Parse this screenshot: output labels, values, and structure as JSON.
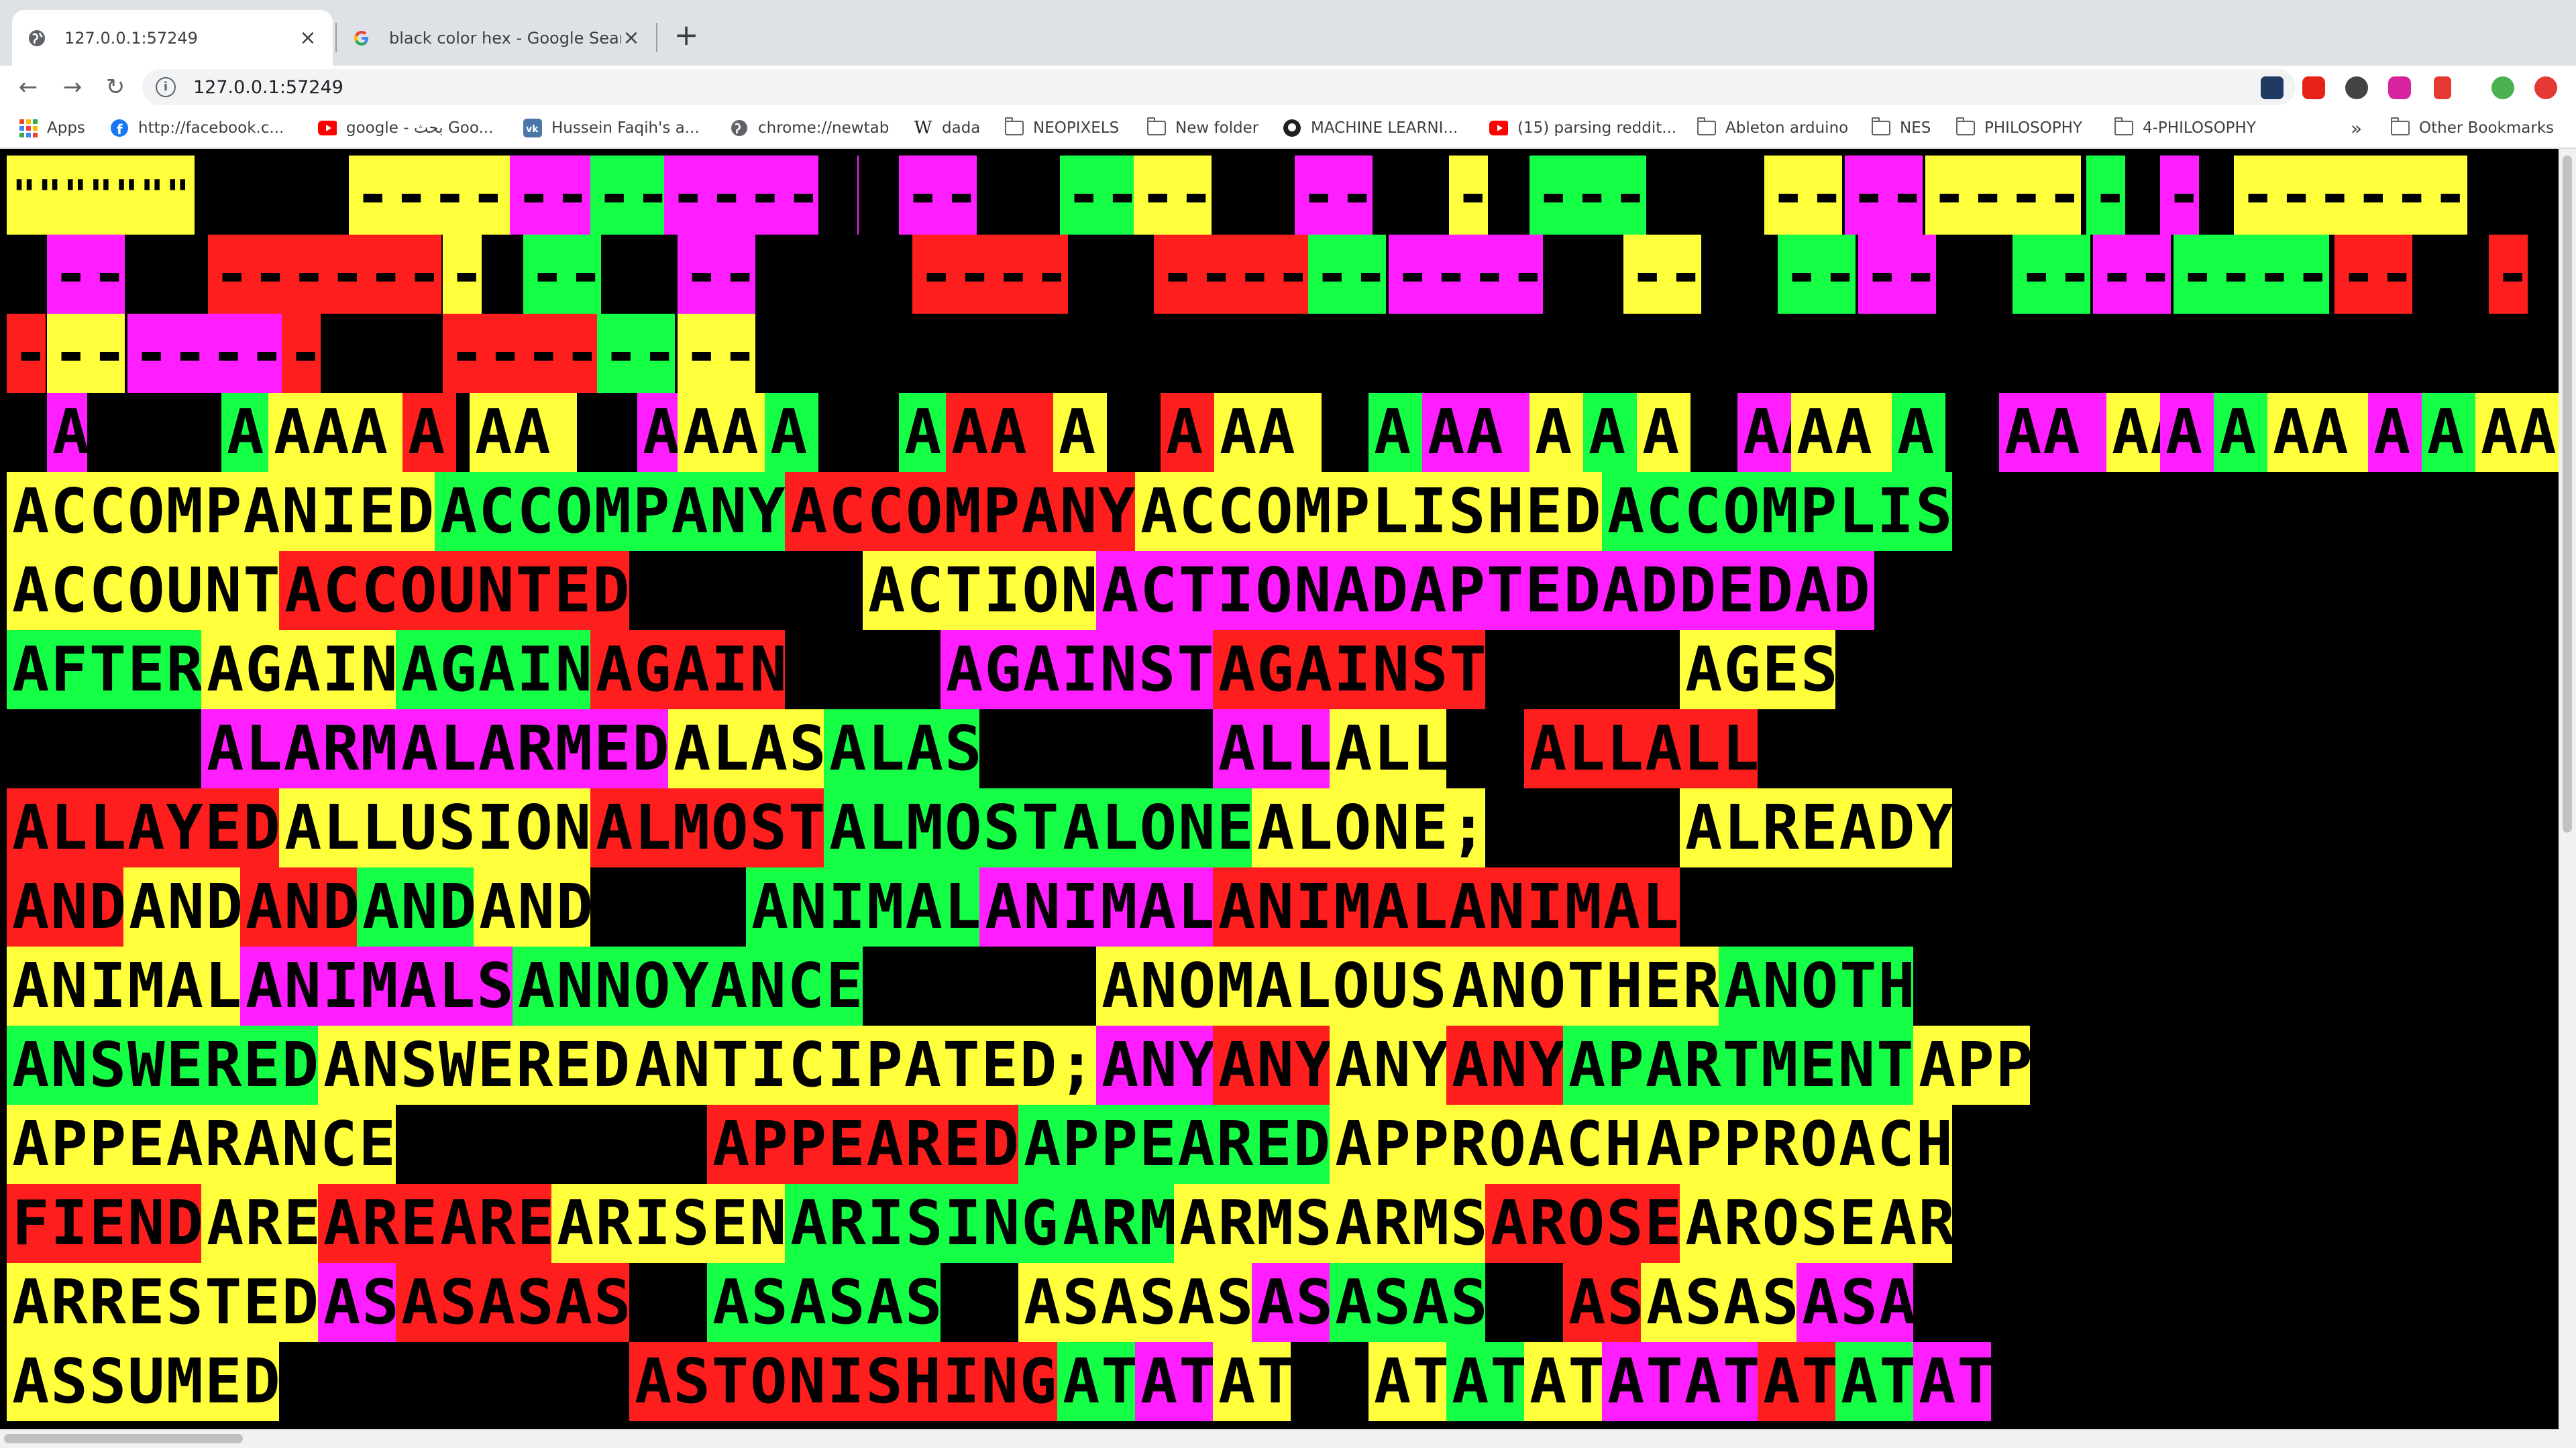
{
  "colors": {
    "yellow": "#ffff3c",
    "magenta": "#ff1eff",
    "green": "#14ff46",
    "red": "#ff1e1e",
    "black": "#000000"
  },
  "tabs": [
    {
      "title": "127.0.0.1:57249",
      "icon": "globe-icon"
    },
    {
      "title": "black color hex - Google Search",
      "icon": "google-icon"
    }
  ],
  "address_bar": {
    "url": "127.0.0.1:57249"
  },
  "bookmarks": [
    {
      "label": "Apps",
      "icon": "apps-grid-icon"
    },
    {
      "label": "http://facebook.c...",
      "icon": "facebook-icon"
    },
    {
      "label": "google - بحث Goo...",
      "icon": "youtube-icon"
    },
    {
      "label": "Hussein Faqih's a...",
      "icon": "vk-icon"
    },
    {
      "label": "chrome://newtab",
      "icon": "globe-icon"
    },
    {
      "label": "dada",
      "icon": "wikipedia-icon"
    },
    {
      "label": "NEOPIXELS",
      "icon": "folder-icon"
    },
    {
      "label": "New folder",
      "icon": "folder-icon"
    },
    {
      "label": "MACHINE LEARNI...",
      "icon": "github-icon"
    },
    {
      "label": "(15) parsing reddit...",
      "icon": "youtube-icon"
    },
    {
      "label": "Ableton arduino",
      "icon": "folder-icon"
    },
    {
      "label": "NES",
      "icon": "folder-icon"
    },
    {
      "label": "PHILOSOPHY",
      "icon": "folder-icon"
    },
    {
      "label": "4-PHILOSOPHY",
      "icon": "folder-icon"
    }
  ],
  "bookmarks_overflow": "»",
  "other_bookmarks": "Other Bookmarks",
  "rows": [
    [
      [
        "y",
        "\"\"\"\"\"\"\" \""
      ]
    ],
    [],
    [],
    [],
    [
      [
        "y",
        "ACCOMPANIED"
      ],
      [
        "g",
        "ACCOMPANY"
      ],
      [
        "r",
        "ACCOMPANY"
      ],
      [
        "y",
        "ACCOMPLISHED"
      ],
      [
        "g",
        "ACCOMPLIS"
      ]
    ],
    [
      [
        "y",
        "ACCOUNT"
      ],
      [
        "r",
        "ACCOUNTED"
      ],
      [
        "k",
        "      "
      ],
      [
        "y",
        "ACTION"
      ],
      [
        "m",
        "ACTIONADAPTEDADDEDAD"
      ]
    ],
    [
      [
        "g",
        "AFTER"
      ],
      [
        "y",
        "AGAIN"
      ],
      [
        "g",
        "AGAIN"
      ],
      [
        "r",
        "AGAIN"
      ],
      [
        "k",
        "    "
      ],
      [
        "m",
        "AGAINST"
      ],
      [
        "r",
        "AGAINST"
      ],
      [
        "k",
        "     "
      ],
      [
        "y",
        "AGES"
      ]
    ],
    [
      [
        "k",
        "     "
      ],
      [
        "m",
        "ALARM"
      ],
      [
        "m",
        "ALARMED"
      ],
      [
        "y",
        "ALAS"
      ],
      [
        "g",
        "ALAS"
      ],
      [
        "k",
        "      "
      ],
      [
        "m",
        "ALL"
      ],
      [
        "y",
        "ALL"
      ],
      [
        "k",
        "  "
      ],
      [
        "r",
        "ALLALL"
      ]
    ],
    [
      [
        "r",
        "ALLAYED"
      ],
      [
        "y",
        "ALLUSION"
      ],
      [
        "r",
        "ALMOST"
      ],
      [
        "g",
        "ALMOST"
      ],
      [
        "g",
        "ALONE"
      ],
      [
        "y",
        "ALONE;"
      ],
      [
        "k",
        "     "
      ],
      [
        "y",
        "ALREADY"
      ]
    ],
    [
      [
        "r",
        "AND"
      ],
      [
        "y",
        "AND"
      ],
      [
        "r",
        "AND"
      ],
      [
        "g",
        "AND"
      ],
      [
        "y",
        "AND"
      ],
      [
        "k",
        "    "
      ],
      [
        "g",
        "ANIMAL"
      ],
      [
        "m",
        "ANIMAL"
      ],
      [
        "r",
        "ANIMALANIMAL"
      ]
    ],
    [
      [
        "y",
        "ANIMAL"
      ],
      [
        "m",
        "ANIMALS"
      ],
      [
        "g",
        "ANNOYANCE"
      ],
      [
        "k",
        "      "
      ],
      [
        "y",
        "ANOMALOUS"
      ],
      [
        "y",
        "ANOTHER"
      ],
      [
        "g",
        "ANOTH"
      ]
    ],
    [
      [
        "g",
        "ANSWERED"
      ],
      [
        "y",
        "ANSWERED"
      ],
      [
        "y",
        "ANTICIPATED;"
      ],
      [
        "m",
        "ANY"
      ],
      [
        "r",
        "ANY"
      ],
      [
        "y",
        "ANY"
      ],
      [
        "r",
        "ANY"
      ],
      [
        "g",
        "APARTMENT"
      ],
      [
        "y",
        "APP"
      ]
    ],
    [
      [
        "y",
        "APPEARANCE"
      ],
      [
        "k",
        "        "
      ],
      [
        "r",
        "APPEARED"
      ],
      [
        "g",
        "APPEARED"
      ],
      [
        "y",
        "APPROACH"
      ],
      [
        "y",
        "APPROACH"
      ]
    ],
    [
      [
        "r",
        "FIEND"
      ],
      [
        "y",
        "ARE"
      ],
      [
        "r",
        "ARE"
      ],
      [
        "r",
        "ARE"
      ],
      [
        "y",
        "ARISEN"
      ],
      [
        "g",
        "ARISING"
      ],
      [
        "g",
        "ARM"
      ],
      [
        "y",
        "ARMS"
      ],
      [
        "y",
        "ARMS"
      ],
      [
        "r",
        "AROSE"
      ],
      [
        "y",
        "AROSE"
      ],
      [
        "y",
        "AR"
      ]
    ],
    [
      [
        "y",
        "ARRESTED"
      ],
      [
        "m",
        "AS"
      ],
      [
        "r",
        "ASASAS"
      ],
      [
        "k",
        "  "
      ],
      [
        "g",
        "ASASAS"
      ],
      [
        "k",
        "  "
      ],
      [
        "y",
        "ASASAS"
      ],
      [
        "m",
        "AS"
      ],
      [
        "g",
        "ASAS"
      ],
      [
        "k",
        "  "
      ],
      [
        "r",
        "AS"
      ],
      [
        "y",
        "ASAS"
      ],
      [
        "m",
        "ASA"
      ]
    ],
    [
      [
        "y",
        "ASSUMED"
      ],
      [
        "k",
        "         "
      ],
      [
        "r",
        "ASTONISHING"
      ],
      [
        "g",
        "AT"
      ],
      [
        "m",
        "AT"
      ],
      [
        "y",
        "AT"
      ],
      [
        "k",
        "  "
      ],
      [
        "y",
        "AT"
      ],
      [
        "g",
        "AT"
      ],
      [
        "y",
        "AT"
      ],
      [
        "m",
        "ATAT"
      ],
      [
        "r",
        "AT"
      ],
      [
        "g",
        "AT"
      ],
      [
        "m",
        "AT"
      ]
    ]
  ]
}
